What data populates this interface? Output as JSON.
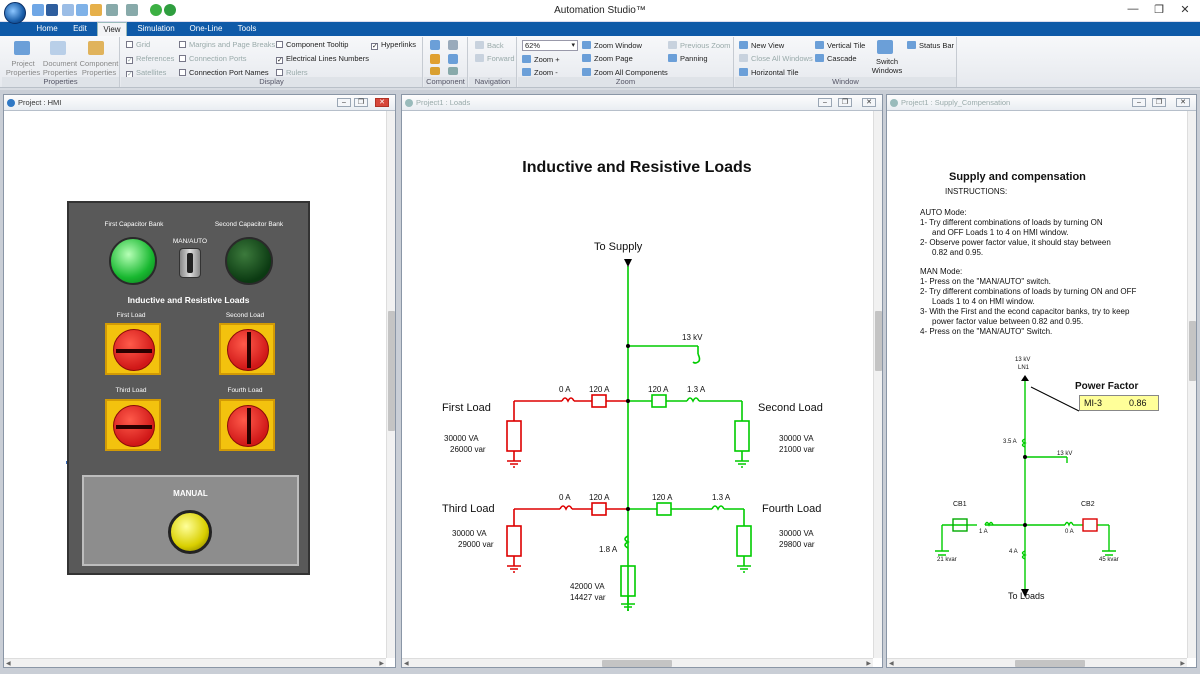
{
  "app": {
    "title": "Automation Studio™"
  },
  "window_controls": {
    "minimize": "—",
    "maximize": "❐",
    "close": "✕"
  },
  "tabs": [
    {
      "label": "Home"
    },
    {
      "label": "Edit"
    },
    {
      "label": "View"
    },
    {
      "label": "Simulation"
    },
    {
      "label": "One-Line"
    },
    {
      "label": "Tools"
    }
  ],
  "ribbon": {
    "properties": {
      "label": "Properties",
      "project": "Project Properties",
      "document": "Document Properties",
      "component": "Component Properties"
    },
    "display": {
      "label": "Display",
      "grid": "Grid",
      "references": "References",
      "satellites": "Satellites",
      "margins": "Margins and Page Breaks",
      "connection_ports": "Connection Ports",
      "connection_port_names": "Connection Port Names",
      "component_tooltip": "Component Tooltip",
      "electrical_lines_numbers": "Electrical Lines Numbers",
      "rulers": "Rulers",
      "hyperlinks": "Hyperlinks"
    },
    "component": {
      "label": "Component"
    },
    "navigation": {
      "label": "Navigation",
      "back": "Back",
      "forward": "Forward"
    },
    "zoom": {
      "label": "Zoom",
      "value": "62%",
      "zoom_in": "Zoom +",
      "zoom_out": "Zoom -",
      "zoom_window": "Zoom Window",
      "zoom_page": "Zoom Page",
      "zoom_all": "Zoom All Components",
      "previous_zoom": "Previous Zoom",
      "panning": "Panning"
    },
    "window": {
      "label": "Window",
      "new_view": "New View",
      "close_all": "Close All Windows",
      "horizontal_tile": "Horizontal Tile",
      "vertical_tile": "Vertical Tile",
      "cascade": "Cascade",
      "switch_windows": "Switch Windows",
      "status_bar": "Status Bar"
    }
  },
  "windows": {
    "hmi": {
      "title": "Project : HMI"
    },
    "loads": {
      "title": "Project1 : Loads"
    },
    "supply": {
      "title": "Project1 : Supply_Compensation"
    }
  },
  "hmi": {
    "first_cap": "First Capacitor Bank",
    "second_cap": "Second Capacitor Bank",
    "man_auto": "MAN/AUTO",
    "heading": "Inductive and Resistive Loads",
    "first_load": "First Load",
    "second_load": "Second Load",
    "third_load": "Third Load",
    "fourth_load": "Fourth Load",
    "manual": "MANUAL"
  },
  "loads": {
    "title": "Inductive and Resistive Loads",
    "supply": "To Supply",
    "kv": "13 kV",
    "first": {
      "name": "First Load",
      "va": "30000 VA",
      "var": "26000 var",
      "a1": "0 A",
      "a2": "120 A"
    },
    "second": {
      "name": "Second Load",
      "va": "30000 VA",
      "var": "21000 var",
      "a1": "120 A",
      "a2": "1.3 A"
    },
    "third": {
      "name": "Third Load",
      "va": "30000 VA",
      "var": "29000 var",
      "a1": "0 A",
      "a2": "120 A"
    },
    "fourth": {
      "name": "Fourth Load",
      "va": "30000 VA",
      "var": "29800 var",
      "a1": "120 A",
      "a2": "1.3 A"
    },
    "bottom": {
      "amps": "1.8 A",
      "va": "42000 VA",
      "var": "14427 var"
    }
  },
  "supply": {
    "title": "Supply and compensation",
    "instructions": "INSTRUCTIONS:",
    "auto_head": "AUTO Mode:",
    "auto_1": "1- Try different combinations of loads by turning ON",
    "auto_1b": "and OFF Loads 1 to 4 on HMI window.",
    "auto_2": "2- Observe power factor value, it should stay between",
    "auto_2b": "0.82 and 0.95.",
    "man_head": "MAN Mode:",
    "man_1": "1- Press on the \"MAN/AUTO\" switch.",
    "man_2": "2- Try different combinations of loads by turning ON and OFF",
    "man_2b": "Loads 1 to 4 on HMI window.",
    "man_3": "3- With the First and the econd capacitor banks, try to keep",
    "man_3b": "power factor value between 0.82 and 0.95.",
    "man_4": "4- Press on the \"MAN/AUTO\" Switch.",
    "pf_label": "Power Factor",
    "meter_id": "MI-3",
    "meter_value": "0.86",
    "kv_top": "13 kV",
    "ln1": "LN1",
    "kv_mid": "13 kV",
    "a_top": "3.5 A",
    "cb1": "CB1",
    "cb2": "CB2",
    "cb1_a": "1 A",
    "cb2_a": "0 A",
    "a_bot": "4 A",
    "kvar1": "21 kvar",
    "kvar2": "45 kvar",
    "to_loads": "To Loads"
  },
  "colors": {
    "accent": "#0f5aa8",
    "energized": "#00cc00",
    "off": "#dd0000",
    "panel": "#595959",
    "meter": "#ffff99"
  }
}
